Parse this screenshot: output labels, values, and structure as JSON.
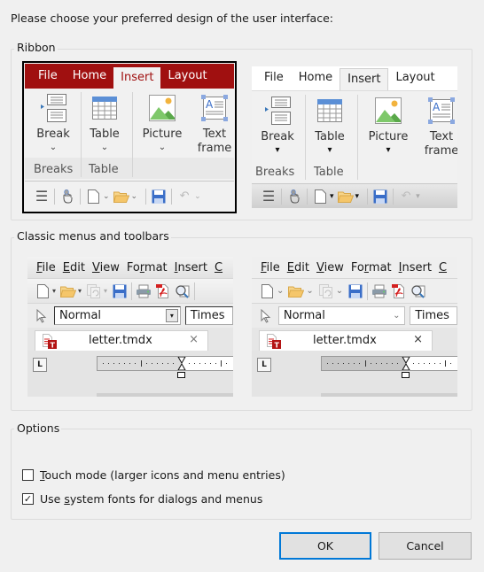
{
  "dialog": {
    "prompt": "Please choose your preferred design of the user interface:"
  },
  "ribbon_group": {
    "label": "Ribbon",
    "previews": [
      {
        "style": "red",
        "selected": true,
        "tabs": [
          "File",
          "Home",
          "Insert",
          "Layout"
        ],
        "active_tab": "Insert",
        "buttons": [
          {
            "label": "Break",
            "icon": "page-break-icon"
          },
          {
            "label": "Table",
            "icon": "table-icon"
          },
          {
            "label": "Picture",
            "icon": "picture-icon"
          },
          {
            "label": "Text frame",
            "label_line1": "Text",
            "label_line2": "frame",
            "icon": "text-frame-icon"
          }
        ],
        "groups": [
          "Breaks",
          "Table"
        ],
        "caret": "⌄",
        "quick_access": [
          "menu-icon",
          "touch-hand-icon",
          "new-document-icon",
          "open-folder-icon",
          "save-icon",
          "undo-icon"
        ]
      },
      {
        "style": "light",
        "selected": false,
        "tabs": [
          "File",
          "Home",
          "Insert",
          "Layout"
        ],
        "active_tab": "Insert",
        "buttons": [
          {
            "label": "Break",
            "icon": "page-break-icon"
          },
          {
            "label": "Table",
            "icon": "table-icon"
          },
          {
            "label": "Picture",
            "icon": "picture-icon"
          },
          {
            "label": "Text frame",
            "label_line1": "Text",
            "label_line2": "frame",
            "icon": "text-frame-icon"
          }
        ],
        "groups": [
          "Breaks",
          "Table"
        ],
        "caret": "▾",
        "quick_access": [
          "menu-icon",
          "touch-hand-icon",
          "new-document-icon",
          "open-folder-icon",
          "save-icon",
          "undo-icon"
        ]
      }
    ]
  },
  "classic_group": {
    "label": "Classic menus and toolbars",
    "previews": [
      {
        "style": "windows",
        "menus": [
          {
            "mn": "F",
            "rest": "ile"
          },
          {
            "mn": "E",
            "rest": "dit"
          },
          {
            "mn": "V",
            "rest": "iew"
          },
          {
            "pre": "Fo",
            "mn": "r",
            "rest": "mat"
          },
          {
            "mn": "I",
            "rest": "nsert"
          },
          {
            "mn": "C",
            "rest": ""
          }
        ],
        "caret": "▾",
        "style_combo_value": "Normal",
        "font_combo_value": "Times",
        "document_tab": "letter.tmdx",
        "close_glyph": "×",
        "tabstop_glyph": "L"
      },
      {
        "style": "modern",
        "menus": [
          {
            "mn": "F",
            "rest": "ile"
          },
          {
            "mn": "E",
            "rest": "dit"
          },
          {
            "mn": "V",
            "rest": "iew"
          },
          {
            "pre": "Fo",
            "mn": "r",
            "rest": "mat"
          },
          {
            "mn": "I",
            "rest": "nsert"
          },
          {
            "mn": "C",
            "rest": ""
          }
        ],
        "caret": "⌄",
        "style_combo_value": "Normal",
        "font_combo_value": "Times",
        "document_tab": "letter.tmdx",
        "close_glyph": "×",
        "tabstop_glyph": "L"
      }
    ]
  },
  "options_group": {
    "label": "Options",
    "touch_mode": {
      "mnemonic": "T",
      "rest": "ouch mode (larger icons and menu entries)",
      "checked": false
    },
    "system_fonts": {
      "pre": "Use ",
      "mnemonic": "s",
      "rest": "ystem fonts for dialogs and menus",
      "checked": true
    },
    "check_glyph": "✓"
  },
  "buttons": {
    "ok": "OK",
    "cancel": "Cancel"
  },
  "colors": {
    "ribbon_red": "#a01010",
    "focus_blue": "#0078d7",
    "save_blue": "#3a6ec8",
    "folder_orange": "#f5c66a",
    "pdf_red": "#d42020"
  }
}
